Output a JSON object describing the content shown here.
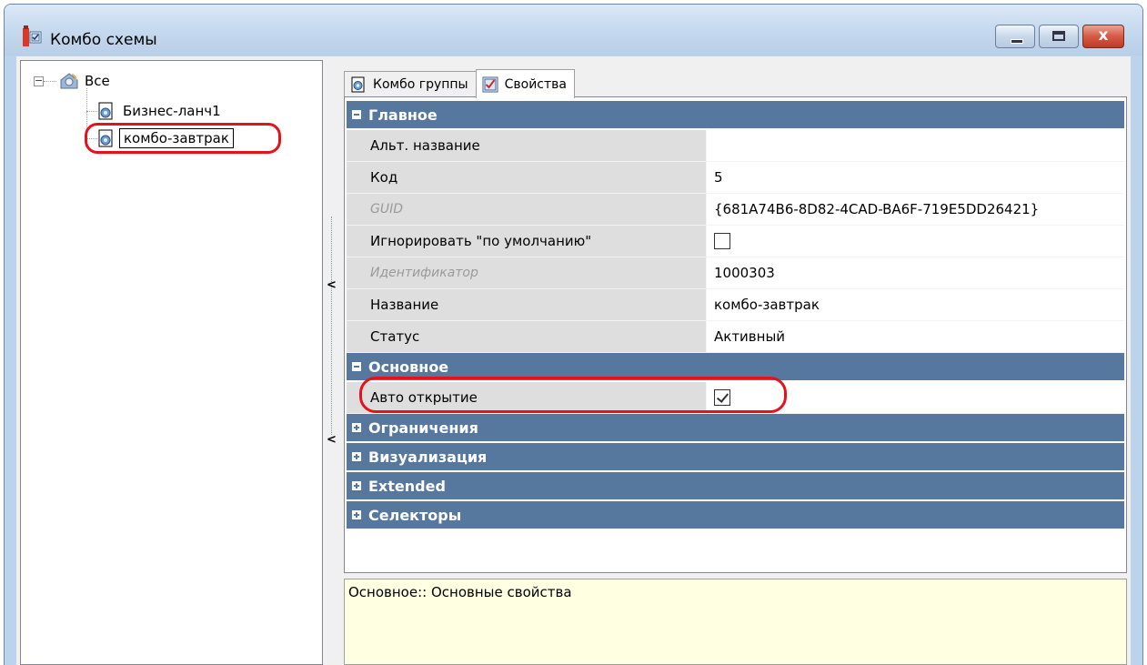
{
  "window": {
    "title": "Комбо схемы",
    "close_glyph": "x"
  },
  "tree": {
    "root": {
      "label": "Все",
      "expander": "−"
    },
    "children": [
      {
        "label": "Бизнес-ланч1"
      },
      {
        "label": "комбо-завтрак",
        "selected": true
      }
    ]
  },
  "splitter": {
    "arrow_top": "<",
    "arrow_bottom": "<"
  },
  "tabs": [
    {
      "label": "Комбо группы",
      "active": false
    },
    {
      "label": "Свойства",
      "active": true
    }
  ],
  "property_grid": {
    "categories": [
      {
        "label": "Главное",
        "expanded": true,
        "rows": [
          {
            "name": "Альт. название",
            "value": ""
          },
          {
            "name": "Код",
            "value": "5"
          },
          {
            "name": "GUID",
            "value": "{681A74B6-8D82-4CAD-BA6F-719E5DD26421}",
            "readonly": true
          },
          {
            "name": "Игнорировать \"по умолчанию\"",
            "value": "",
            "checkbox": true,
            "checked": false
          },
          {
            "name": "Идентификатор",
            "value": "1000303",
            "readonly": true
          },
          {
            "name": "Название",
            "value": "комбо-завтрак"
          },
          {
            "name": "Статус",
            "value": "Активный"
          }
        ]
      },
      {
        "label": "Основное",
        "expanded": true,
        "rows": [
          {
            "name": "Авто открытие",
            "value": "",
            "checkbox": true,
            "checked": true
          }
        ]
      },
      {
        "label": "Ограничения",
        "expanded": false
      },
      {
        "label": "Визуализация",
        "expanded": false
      },
      {
        "label": "Extended",
        "expanded": false
      },
      {
        "label": "Селекторы",
        "expanded": false
      }
    ]
  },
  "description": "Основное:: Основные свойства",
  "colors": {
    "category_bg": "#56779e",
    "highlight": "#e5121b",
    "description_bg": "#ffffe1"
  }
}
